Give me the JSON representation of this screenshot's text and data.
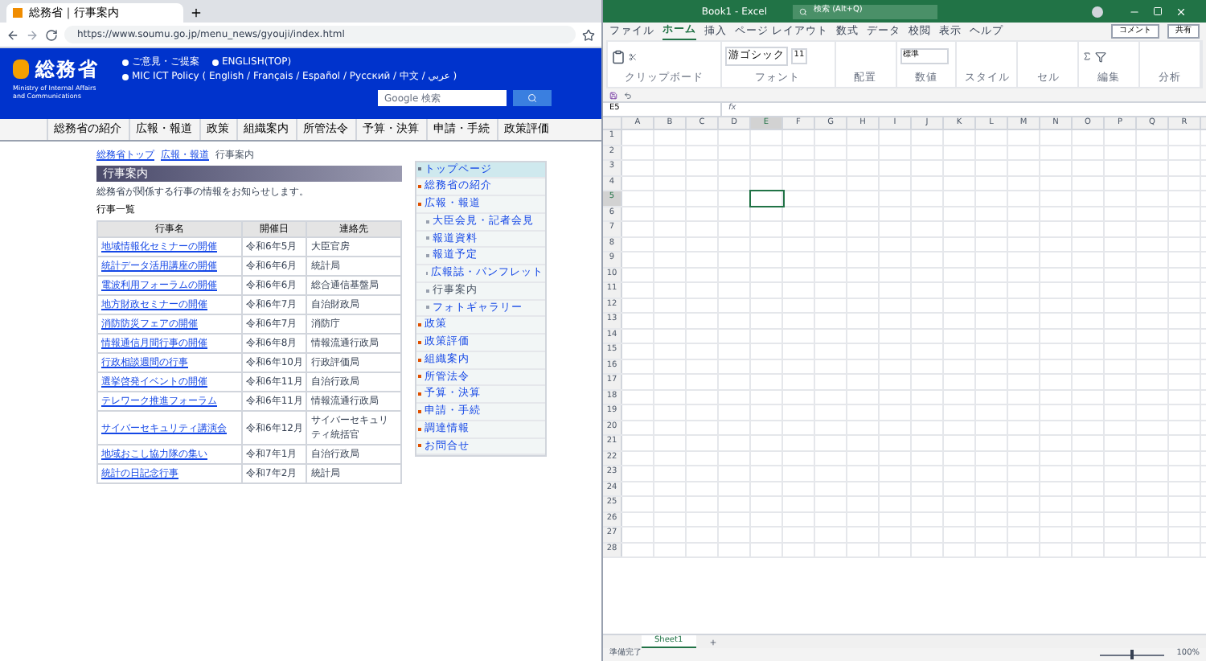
{
  "browser": {
    "tab_title": "総務省｜行事案内",
    "url": "https://www.soumu.go.jp/menu_news/gyouji/index.html"
  },
  "site": {
    "logo_text": "総務省",
    "logo_sub": "Ministry of Internal Affairs and Communications",
    "header_links": [
      "ご意見・ご提案",
      "ENGLISH(TOP)",
      "MIC ICT Policy ( English / Français / Español / Русский / 中文 / عربي )"
    ],
    "search_placeholder": "Google 検索",
    "nav": [
      "総務省の紹介",
      "広報・報道",
      "政策",
      "組織案内",
      "所管法令",
      "予算・決算",
      "申請・手続",
      "政策評価"
    ],
    "breadcrumb": [
      "総務省トップ",
      "広報・報道",
      "行事案内"
    ],
    "page_title": "行事案内",
    "intro": "総務省が関係する行事の情報をお知らせします。",
    "list_heading": "行事一覧",
    "columns": [
      "行事名",
      "開催日",
      "連絡先"
    ],
    "rows": [
      [
        "地域情報化セミナーの開催",
        "令和6年5月",
        "大臣官房"
      ],
      [
        "統計データ活用講座の開催",
        "令和6年6月",
        "統計局"
      ],
      [
        "電波利用フォーラムの開催",
        "令和6年6月",
        "総合通信基盤局"
      ],
      [
        "地方財政セミナーの開催",
        "令和6年7月",
        "自治財政局"
      ],
      [
        "消防防災フェアの開催",
        "令和6年7月",
        "消防庁"
      ],
      [
        "情報通信月間行事の開催",
        "令和6年8月",
        "情報流通行政局"
      ],
      [
        "行政相談週間の行事",
        "令和6年10月",
        "行政評価局"
      ],
      [
        "選挙啓発イベントの開催",
        "令和6年11月",
        "自治行政局"
      ],
      [
        "テレワーク推進フォーラム",
        "令和6年11月",
        "情報流通行政局"
      ],
      [
        "サイバーセキュリティ講演会",
        "令和6年12月",
        "サイバーセキュリティ統括官"
      ],
      [
        "地域おこし協力隊の集い",
        "令和7年1月",
        "自治行政局"
      ],
      [
        "統計の日記念行事",
        "令和7年2月",
        "統計局"
      ]
    ],
    "sidebar": [
      {
        "label": "トップページ",
        "kind": "top"
      },
      {
        "label": "総務省の紹介",
        "kind": "item"
      },
      {
        "label": "広報・報道",
        "kind": "item"
      },
      {
        "label": "大臣会見・記者会見",
        "kind": "sub"
      },
      {
        "label": "報道資料",
        "kind": "sub"
      },
      {
        "label": "報道予定",
        "kind": "sub"
      },
      {
        "label": "広報誌・パンフレット",
        "kind": "sub"
      },
      {
        "label": "行事案内",
        "kind": "current"
      },
      {
        "label": "フォトギャラリー",
        "kind": "sub"
      },
      {
        "label": "政策",
        "kind": "item"
      },
      {
        "label": "政策評価",
        "kind": "item"
      },
      {
        "label": "組織案内",
        "kind": "item"
      },
      {
        "label": "所管法令",
        "kind": "item"
      },
      {
        "label": "予算・決算",
        "kind": "item"
      },
      {
        "label": "申請・手続",
        "kind": "item"
      },
      {
        "label": "調達情報",
        "kind": "item"
      },
      {
        "label": "お問合せ",
        "kind": "item"
      }
    ]
  },
  "excel": {
    "title": "Book1 - Excel",
    "search": "検索 (Alt+Q)",
    "ribbon_tabs": [
      {
        "label": "ファイル",
        "selected": false
      },
      {
        "label": "ホーム",
        "selected": true
      },
      {
        "label": "挿入",
        "selected": false
      },
      {
        "label": "ページ レイアウト",
        "selected": false
      },
      {
        "label": "数式",
        "selected": false
      },
      {
        "label": "データ",
        "selected": false
      },
      {
        "label": "校閲",
        "selected": false
      },
      {
        "label": "表示",
        "selected": false
      },
      {
        "label": "ヘルプ",
        "selected": false
      }
    ],
    "comment": "コメント",
    "share": "共有",
    "font": "游ゴシック",
    "font_size": "11",
    "number_format": "標準",
    "groups": [
      "クリップボード",
      "フォント",
      "配置",
      "数値",
      "スタイル",
      "セル",
      "編集",
      "分析"
    ],
    "name_box": "E5",
    "columns": [
      {
        "label": "A",
        "selected": false
      },
      {
        "label": "B",
        "selected": false
      },
      {
        "label": "C",
        "selected": false
      },
      {
        "label": "D",
        "selected": false
      },
      {
        "label": "E",
        "selected": true
      },
      {
        "label": "F",
        "selected": false
      },
      {
        "label": "G",
        "selected": false
      },
      {
        "label": "H",
        "selected": false
      },
      {
        "label": "I",
        "selected": false
      },
      {
        "label": "J",
        "selected": false
      },
      {
        "label": "K",
        "selected": false
      },
      {
        "label": "L",
        "selected": false
      },
      {
        "label": "M",
        "selected": false
      },
      {
        "label": "N",
        "selected": false
      },
      {
        "label": "O",
        "selected": false
      },
      {
        "label": "P",
        "selected": false
      },
      {
        "label": "Q",
        "selected": false
      },
      {
        "label": "R",
        "selected": false
      }
    ],
    "rows": [
      {
        "label": "1",
        "selected": false
      },
      {
        "label": "2",
        "selected": false
      },
      {
        "label": "3",
        "selected": false
      },
      {
        "label": "4",
        "selected": false
      },
      {
        "label": "5",
        "selected": true
      },
      {
        "label": "6",
        "selected": false
      },
      {
        "label": "7",
        "selected": false
      },
      {
        "label": "8",
        "selected": false
      },
      {
        "label": "9",
        "selected": false
      },
      {
        "label": "10",
        "selected": false
      },
      {
        "label": "11",
        "selected": false
      },
      {
        "label": "12",
        "selected": false
      },
      {
        "label": "13",
        "selected": false
      },
      {
        "label": "14",
        "selected": false
      },
      {
        "label": "15",
        "selected": false
      },
      {
        "label": "16",
        "selected": false
      },
      {
        "label": "17",
        "selected": false
      },
      {
        "label": "18",
        "selected": false
      },
      {
        "label": "19",
        "selected": false
      },
      {
        "label": "20",
        "selected": false
      },
      {
        "label": "21",
        "selected": false
      },
      {
        "label": "22",
        "selected": false
      },
      {
        "label": "23",
        "selected": false
      },
      {
        "label": "24",
        "selected": false
      },
      {
        "label": "25",
        "selected": false
      },
      {
        "label": "26",
        "selected": false
      },
      {
        "label": "27",
        "selected": false
      },
      {
        "label": "28",
        "selected": false
      }
    ],
    "function_label": "fx",
    "zoom_slider": {
      "level": 0.5
    },
    "sheet_tabs": [
      {
        "label": "Sheet1",
        "selected": true
      }
    ],
    "status": "準備完了",
    "zoom": "100%"
  }
}
